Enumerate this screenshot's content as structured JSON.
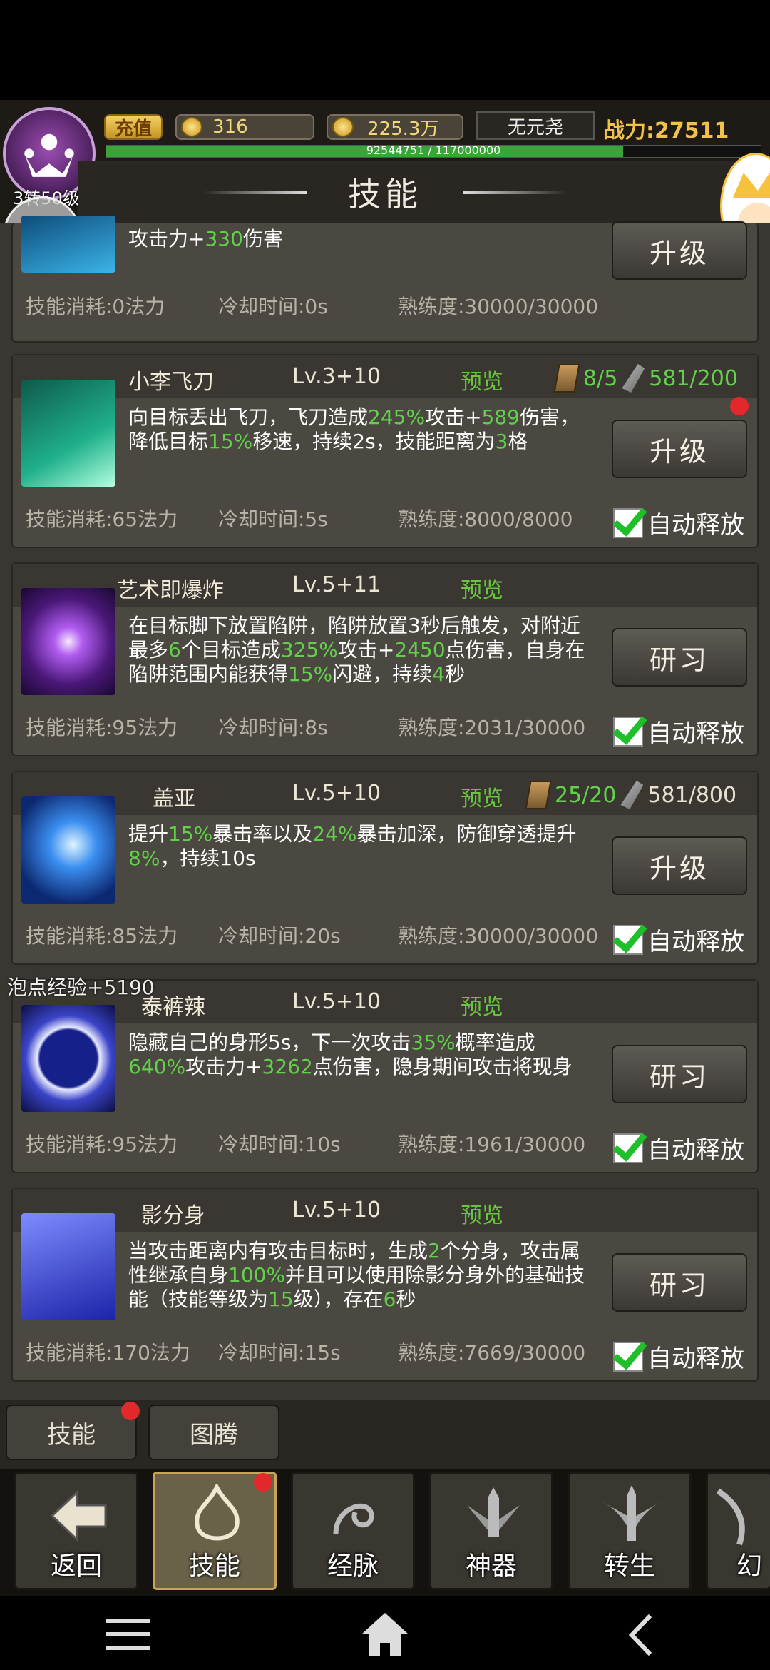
{
  "header": {
    "recharge_label": "充值",
    "gold": "316",
    "ticket": "225.3万",
    "vip_name": "无元尧",
    "power_label": "战力:",
    "power_value": "27511",
    "exp_text": "92544751 / 117000000",
    "exp_progress": 0.79,
    "avatar_level": "3转50级",
    "title": "技能"
  },
  "partial_card": {
    "desc_part": "攻击力+",
    "desc_val": "330",
    "desc_tail": "伤害",
    "button": "升级",
    "cost": "技能消耗:0法力",
    "cooldown": "冷却时间:0s",
    "proficiency": "熟练度:30000/30000"
  },
  "skills": [
    {
      "name": "小李飞刀",
      "level": "Lv.3+10",
      "preview": "预览",
      "book_count": "8/5",
      "material_count": "581/200",
      "desc": [
        [
          "t",
          "向目标丢出飞刀，飞刀造成"
        ],
        [
          "g",
          "245%"
        ],
        [
          "t",
          "攻击+"
        ],
        [
          "g",
          "589"
        ],
        [
          "t",
          "伤害，降低目标"
        ],
        [
          "g",
          "15%"
        ],
        [
          "t",
          "移速，持续2s，技能距离为"
        ],
        [
          "g",
          "3"
        ],
        [
          "t",
          "格"
        ]
      ],
      "button": "升级",
      "cost": "技能消耗:65法力",
      "cooldown": "冷却时间:5s",
      "proficiency": "熟练度:8000/8000",
      "auto": "自动释放"
    },
    {
      "name": "艺术即爆炸",
      "level": "Lv.5+11",
      "preview": "预览",
      "desc": [
        [
          "t",
          "在目标脚下放置陷阱，陷阱放置3秒后触发，对附近最多"
        ],
        [
          "g",
          "6"
        ],
        [
          "t",
          "个目标造成"
        ],
        [
          "g",
          "325%"
        ],
        [
          "t",
          "攻击+"
        ],
        [
          "g",
          "2450"
        ],
        [
          "t",
          "点伤害，自身在陷阱范围内能获得"
        ],
        [
          "g",
          "15%"
        ],
        [
          "t",
          "闪避，持续"
        ],
        [
          "g",
          "4"
        ],
        [
          "t",
          "秒"
        ]
      ],
      "button": "研习",
      "cost": "技能消耗:95法力",
      "cooldown": "冷却时间:8s",
      "proficiency": "熟练度:2031/30000",
      "auto": "自动释放"
    },
    {
      "name": "盖亚",
      "level": "Lv.5+10",
      "preview": "预览",
      "book_count": "25/20",
      "material_count": "581/800",
      "desc": [
        [
          "t",
          "提升"
        ],
        [
          "g",
          "15%"
        ],
        [
          "t",
          "暴击率以及"
        ],
        [
          "g",
          "24%"
        ],
        [
          "t",
          "暴击加深，防御穿透提升"
        ],
        [
          "g",
          "8%"
        ],
        [
          "t",
          "，持续10s"
        ]
      ],
      "button": "升级",
      "cost": "技能消耗:85法力",
      "cooldown": "冷却时间:20s",
      "proficiency": "熟练度:30000/30000",
      "auto": "自动释放"
    },
    {
      "name": "泰裤辣",
      "level": "Lv.5+10",
      "preview": "预览",
      "desc": [
        [
          "t",
          "隐藏自己的身形5s，下一次攻击"
        ],
        [
          "g",
          "35%"
        ],
        [
          "t",
          "概率造成"
        ],
        [
          "g",
          "640%"
        ],
        [
          "t",
          "攻击力+"
        ],
        [
          "g",
          "3262"
        ],
        [
          "t",
          "点伤害，隐身期间攻击将现身"
        ]
      ],
      "button": "研习",
      "cost": "技能消耗:95法力",
      "cooldown": "冷却时间:10s",
      "proficiency": "熟练度:1961/30000",
      "auto": "自动释放"
    },
    {
      "name": "影分身",
      "level": "Lv.5+10",
      "preview": "预览",
      "desc": [
        [
          "t",
          "当攻击距离内有攻击目标时，生成"
        ],
        [
          "g",
          "2"
        ],
        [
          "t",
          "个分身，攻击属性继承自身"
        ],
        [
          "g",
          "100%"
        ],
        [
          "t",
          "并且可以使用除影分身外的基础技能（技能等级为"
        ],
        [
          "g",
          "15"
        ],
        [
          "t",
          "级），存在"
        ],
        [
          "g",
          "6"
        ],
        [
          "t",
          "秒"
        ]
      ],
      "button": "研习",
      "cost": "技能消耗:170法力",
      "cooldown": "冷却时间:15s",
      "proficiency": "熟练度:7669/30000",
      "auto": "自动释放"
    }
  ],
  "floating_exp": "泡点经验+5190",
  "tabs": [
    "技能",
    "图腾"
  ],
  "nav": [
    "返回",
    "技能",
    "经脉",
    "神器",
    "转生",
    "幻"
  ]
}
